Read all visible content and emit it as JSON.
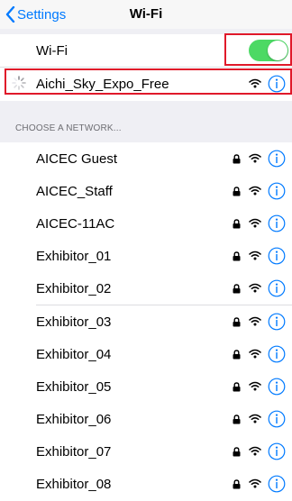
{
  "navbar": {
    "back_label": "Settings",
    "title": "Wi-Fi"
  },
  "wifi_toggle": {
    "label": "Wi-Fi",
    "on": true,
    "on_color": "#4cd964"
  },
  "connected_network": {
    "name": "Aichi_Sky_Expo_Free",
    "locked": false,
    "status": "connecting"
  },
  "section_header": "CHOOSE A NETWORK...",
  "networks": [
    {
      "name": "AICEC Guest",
      "locked": true
    },
    {
      "name": "AICEC_Staff",
      "locked": true
    },
    {
      "name": "AICEC-11AC",
      "locked": true
    },
    {
      "name": "Exhibitor_01",
      "locked": true
    },
    {
      "name": "Exhibitor_02",
      "locked": true
    },
    {
      "name": "Exhibitor_03",
      "locked": true
    },
    {
      "name": "Exhibitor_04",
      "locked": true
    },
    {
      "name": "Exhibitor_05",
      "locked": true
    },
    {
      "name": "Exhibitor_06",
      "locked": true
    },
    {
      "name": "Exhibitor_07",
      "locked": true
    },
    {
      "name": "Exhibitor_08",
      "locked": true
    }
  ],
  "colors": {
    "accent": "#007aff",
    "highlight": "#e0192a",
    "background": "#efeff4"
  },
  "icons": {
    "back": "chevron-left-icon",
    "lock": "lock-icon",
    "wifi": "wifi-icon",
    "info": "info-icon",
    "spinner": "spinner-icon"
  }
}
